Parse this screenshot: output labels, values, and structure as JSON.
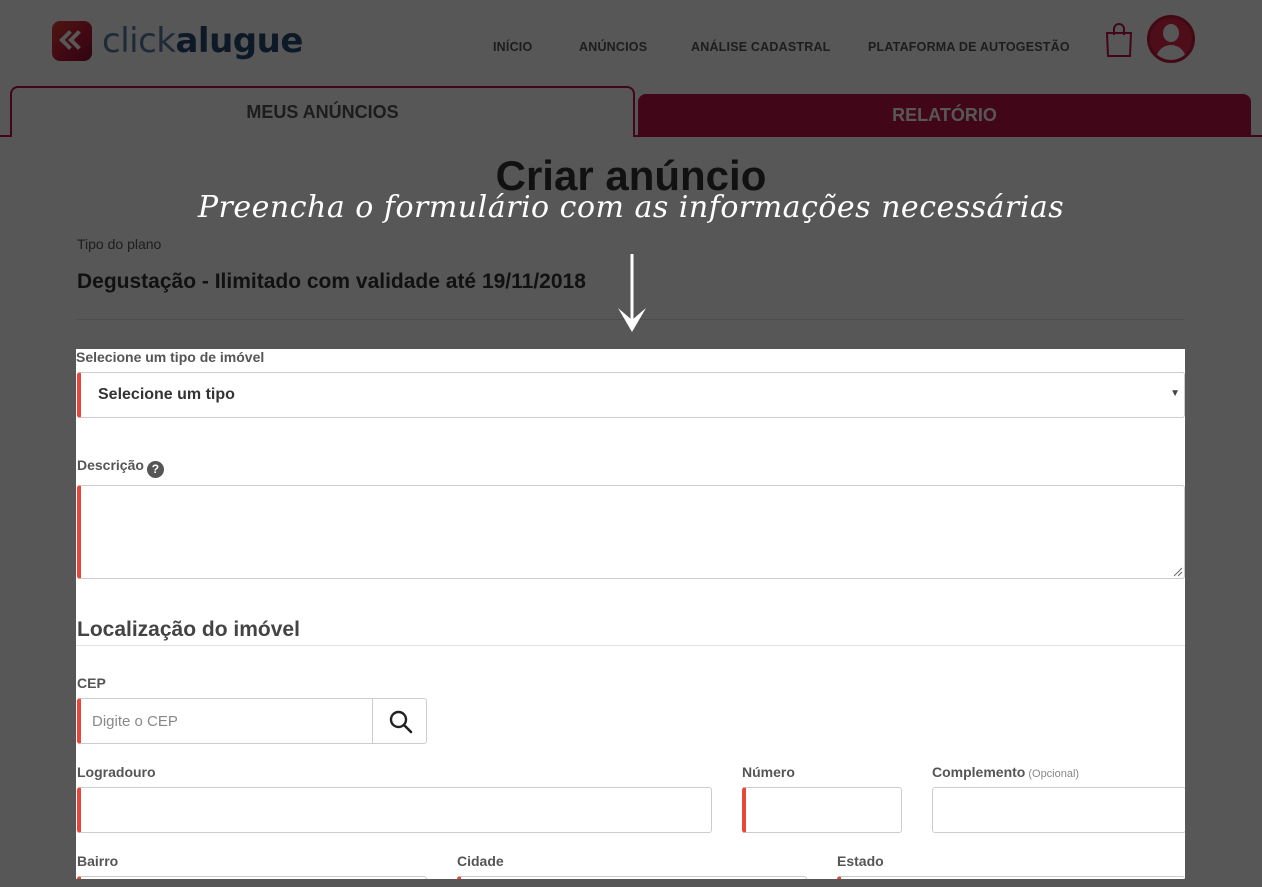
{
  "header": {
    "logo": {
      "text_light": "click",
      "text_bold": "alugue"
    },
    "nav": [
      "INÍCIO",
      "ANÚNCIOS",
      "ANÁLISE CADASTRAL",
      "PLATAFORMA DE AUTOGESTÃO"
    ],
    "icons": {
      "cart": "shopping-bag-icon",
      "avatar": "user-avatar-icon"
    }
  },
  "tabs": [
    {
      "label": "MEUS ANÚNCIOS",
      "active": true
    },
    {
      "label": "RELATÓRIO",
      "active": false
    }
  ],
  "page": {
    "title": "Criar anúncio",
    "plan_label": "Tipo do plano",
    "plan_value": "Degustação - Ilimitado com validade até 19/11/2018"
  },
  "overlay": {
    "hint": "Preencha o formulário com as informações necessárias",
    "arrow_icon": "arrow-down-icon"
  },
  "form": {
    "property_type": {
      "label": "Selecione um tipo de imóvel",
      "selected": "Selecione um tipo"
    },
    "description": {
      "label": "Descrição",
      "help_icon": "question-circle-icon",
      "value": ""
    },
    "location": {
      "title": "Localização do imóvel",
      "cep": {
        "label": "CEP",
        "placeholder": "Digite o CEP",
        "search_icon": "search-icon"
      },
      "logradouro": {
        "label": "Logradouro",
        "value": ""
      },
      "numero": {
        "label": "Número",
        "value": ""
      },
      "complemento": {
        "label": "Complemento",
        "optional": "(Opcional)",
        "value": ""
      },
      "bairro": {
        "label": "Bairro"
      },
      "cidade": {
        "label": "Cidade"
      },
      "estado": {
        "label": "Estado"
      }
    }
  },
  "colors": {
    "brand": "#c0134a",
    "required_marker": "#e9473a",
    "overlay": "rgba(0,0,0,0.66)"
  }
}
